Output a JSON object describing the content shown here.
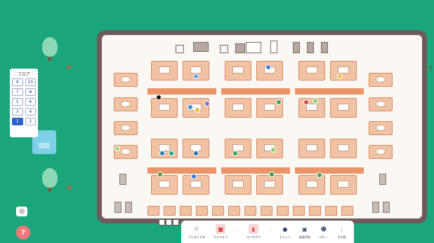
{
  "floor_panel": {
    "title": "フロア",
    "floors": [
      {
        "label": "9",
        "active": false
      },
      {
        "label": "10",
        "active": false
      },
      {
        "label": "7",
        "active": false
      },
      {
        "label": "8",
        "active": false
      },
      {
        "label": "5",
        "active": false
      },
      {
        "label": "6",
        "active": false
      },
      {
        "label": "3",
        "active": false
      },
      {
        "label": "4",
        "active": false
      },
      {
        "label": "1",
        "active": true
      },
      {
        "label": "2",
        "active": false
      }
    ]
  },
  "toolbar": {
    "items": [
      {
        "label": "プレゼンする",
        "icon": "present-icon"
      },
      {
        "label": "カメラオフ",
        "icon": "camera-off-icon"
      },
      {
        "label": "マイクオフ",
        "icon": "mic-off-icon"
      },
      {
        "label": "チャット",
        "icon": "chat-icon"
      },
      {
        "label": "画面共有",
        "icon": "screen-share-icon"
      },
      {
        "label": "ロビー",
        "icon": "lobby-icon"
      },
      {
        "label": "その他",
        "icon": "more-icon"
      }
    ]
  },
  "colors": {
    "background": "#1aa57a",
    "desk": "#f1c2a4",
    "bar": "#eb9468",
    "active_floor": "#2d64c8",
    "help": "#f17878"
  }
}
